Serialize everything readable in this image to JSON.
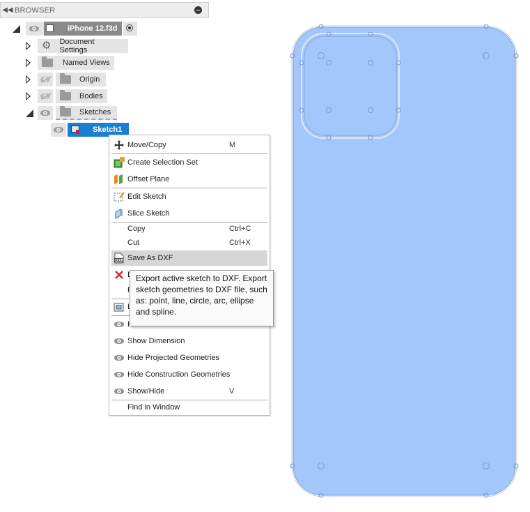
{
  "browser": {
    "title": "BROWSER",
    "document_name": "iPhone 12.f3d",
    "items": [
      {
        "label": "Document Settings"
      },
      {
        "label": "Named Views"
      },
      {
        "label": "Origin"
      },
      {
        "label": "Bodies"
      },
      {
        "label": "Sketches"
      },
      {
        "label": "Sketch1"
      }
    ]
  },
  "context_menu": {
    "items": [
      {
        "label": "Move/Copy",
        "shortcut": "M",
        "icon": "move-icon"
      },
      {
        "label": "Create Selection Set",
        "icon": "selection-set-icon"
      },
      {
        "label": "Offset Plane",
        "icon": "offset-plane-icon"
      },
      {
        "label": "Edit Sketch",
        "icon": "edit-sketch-icon"
      },
      {
        "label": "Slice Sketch",
        "icon": "slice-sketch-icon"
      },
      {
        "label": "Copy",
        "shortcut": "Ctrl+C"
      },
      {
        "label": "Cut",
        "shortcut": "Ctrl+X"
      },
      {
        "label": "Save As DXF",
        "icon": "dxf-icon"
      },
      {
        "label": "De",
        "icon": "delete-icon"
      },
      {
        "label": "Re"
      },
      {
        "label": "Lo",
        "icon": "look-at-icon"
      },
      {
        "label": "Hi",
        "icon": "eye-icon"
      },
      {
        "label": "Show Dimension",
        "icon": "eye-icon"
      },
      {
        "label": "Hide Projected Geometries",
        "icon": "eye-icon"
      },
      {
        "label": "Hide Construction Geometries",
        "icon": "eye-icon"
      },
      {
        "label": "Show/Hide",
        "shortcut": "V",
        "icon": "eye-icon"
      },
      {
        "label": "Find in Window"
      }
    ]
  },
  "tooltip": {
    "text": "Export active sketch to DXF. Export sketch geometries to DXF file, such as: point, line, circle, arc, ellipse and spline."
  },
  "colors": {
    "selection_blue": "#1a7fd1",
    "profile_fill": "#a3c6fb",
    "profile_stroke": "#8ea9d6",
    "menu_highlight": "#d6d6d6"
  }
}
